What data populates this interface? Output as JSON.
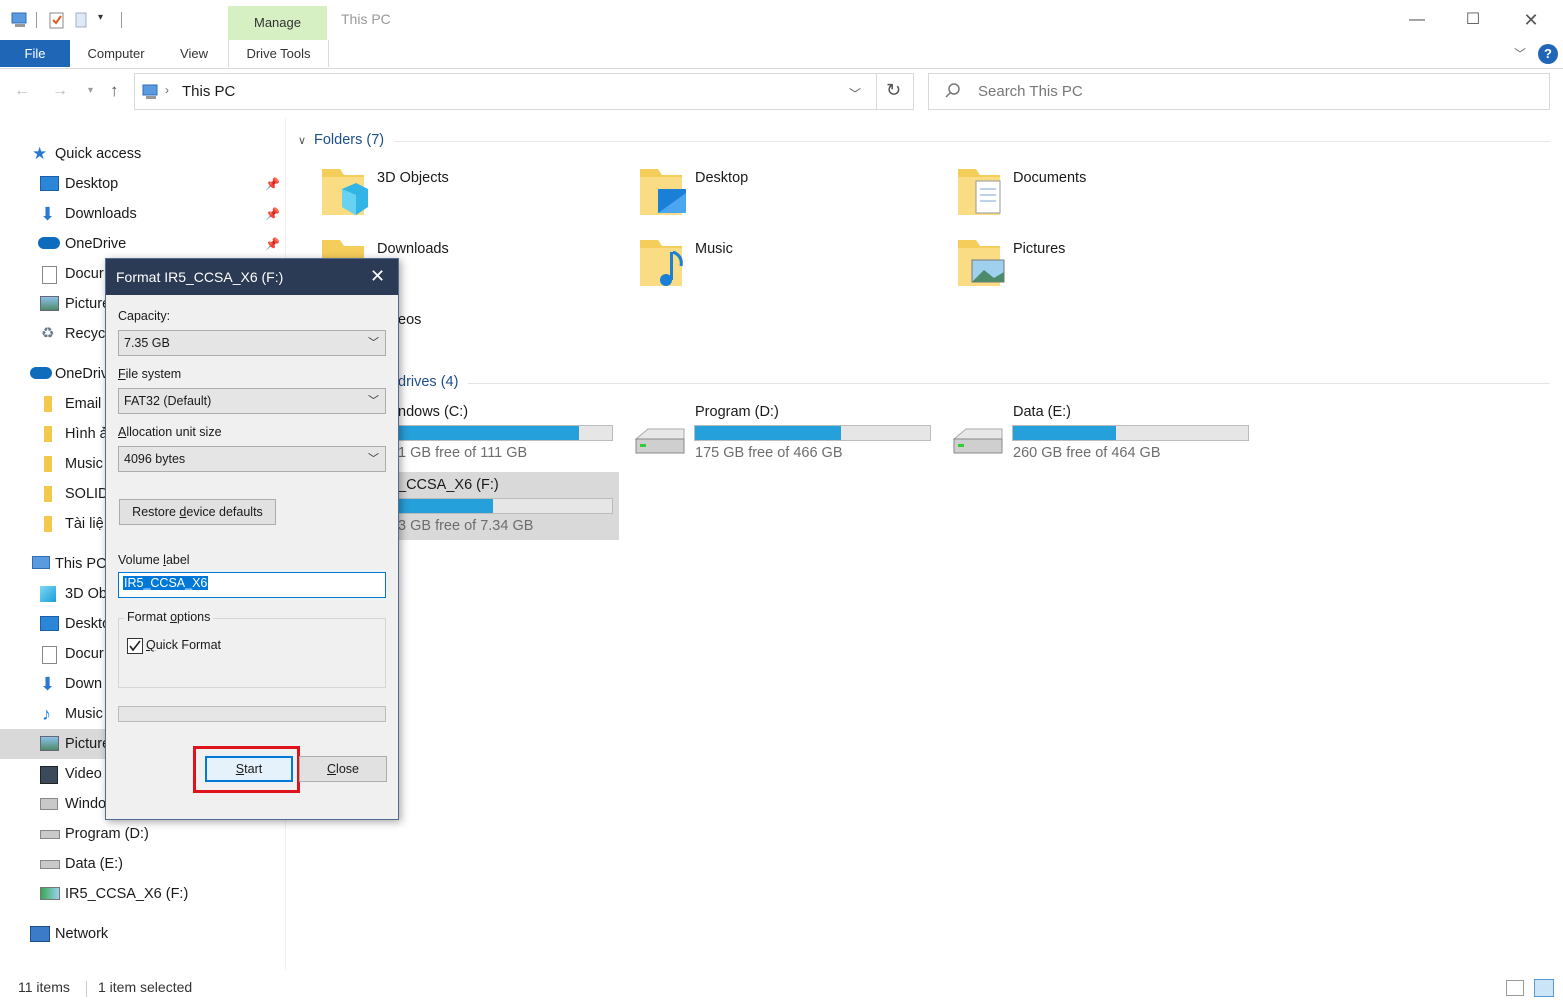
{
  "window": {
    "title": "This PC",
    "manage_tab": "Manage",
    "tabs": [
      "File",
      "Computer",
      "View",
      "Drive Tools"
    ]
  },
  "address": {
    "path": "This PC",
    "search_placeholder": "Search This PC"
  },
  "nav": {
    "quick_access": "Quick access",
    "quick_items": [
      "Desktop",
      "Downloads",
      "OneDrive",
      "Docur",
      "Picture",
      "Recycl"
    ],
    "onedrive": "OneDriv",
    "onedrive_items": [
      "Email",
      "Hình ả",
      "Music",
      "SOLID",
      "Tài liệ"
    ],
    "this_pc": "This PC",
    "pc_items": [
      "3D Ob",
      "Deskto",
      "Docur",
      "Down",
      "Music",
      "Picture",
      "Video",
      "Windo",
      "Program (D:)",
      "Data (E:)",
      "IR5_CCSA_X6 (F:)"
    ],
    "network": "Network"
  },
  "content": {
    "folders_header": "Folders (7)",
    "folders": [
      "3D Objects",
      "Desktop",
      "Documents",
      "Downloads",
      "Music",
      "Pictures",
      "eos"
    ],
    "drives_header": "drives (4)",
    "drives": [
      {
        "name": "ndows (C:)",
        "free": "1 GB free of 111 GB",
        "used_fraction": 0.86
      },
      {
        "name": "Program (D:)",
        "free": "175 GB free of 466 GB",
        "used_fraction": 0.62
      },
      {
        "name": "Data (E:)",
        "free": "260 GB free of 464 GB",
        "used_fraction": 0.44
      },
      {
        "name": "_CCSA_X6 (F:)",
        "free": "3 GB free of 7.34 GB",
        "used_fraction": 0.49
      }
    ]
  },
  "status": {
    "items": "11 items",
    "selected": "1 item selected"
  },
  "dialog": {
    "title": "Format IR5_CCSA_X6 (F:)",
    "capacity_label": "Capacity:",
    "capacity_value": "7.35 GB",
    "fs_label_first": "F",
    "fs_label_rest": "ile system",
    "fs_value": "FAT32 (Default)",
    "alloc_label_first": "A",
    "alloc_label_rest": "llocation unit size",
    "alloc_value": "4096 bytes",
    "restore_pre": "Restore ",
    "restore_u": "d",
    "restore_post": "evice defaults",
    "volume_pre": "Volume ",
    "volume_u": "l",
    "volume_post": "abel",
    "volume_value": "IR5_CCSA_X6",
    "options_pre": "Format ",
    "options_u": "o",
    "options_post": "ptions",
    "quick_pre": "",
    "quick_u": "Q",
    "quick_post": "uick Format",
    "quick_checked": true,
    "start_u": "S",
    "start_post": "tart",
    "close_u": "C",
    "close_post": "lose"
  },
  "colors": {
    "accent": "#1f66b7",
    "bar_fill": "#26a0da",
    "highlight_box": "#e0121b",
    "manage_tab_bg": "#d7f0c3"
  }
}
